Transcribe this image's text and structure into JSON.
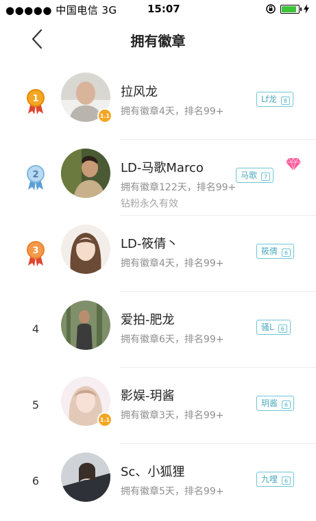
{
  "status_bar": {
    "carrier": "●●●●● 中国电信  3G",
    "time": "15:07"
  },
  "nav": {
    "title": "拥有徽章"
  },
  "colors": {
    "badge_teal": "#6cc5d6",
    "gold_medal": "#f5a623",
    "silver_medal": "#7fb7e0",
    "bronze_medal": "#e8822f",
    "diamond": "#ff5a9a"
  },
  "rows": [
    {
      "rank": "1",
      "name": "拉风龙",
      "sub": "拥有徽章4天，排名99+",
      "badge_label": "Lf龙",
      "badge_level": "8",
      "has_lv_badge": true,
      "lv_text": "1.1"
    },
    {
      "rank": "2",
      "name": "LD-马歌Marco",
      "sub": "拥有徽章122天，排名99+",
      "sub2": "钻粉永久有效",
      "badge_label": "马歌",
      "badge_level": "7"
    },
    {
      "rank": "3",
      "name": "LD-筱倩丶",
      "sub": "拥有徽章4天，排名99+",
      "badge_label": "筱倩",
      "badge_level": "6"
    },
    {
      "rank": "4",
      "name": "爱拍-肥龙",
      "sub": "拥有徽章6天，排名99+",
      "badge_label": "骚L",
      "badge_level": "6"
    },
    {
      "rank": "5",
      "name": "影娱-玥酱",
      "sub": "拥有徽章3天，排名99+",
      "badge_label": "玥酱",
      "badge_level": "6",
      "has_lv_badge": true,
      "lv_text": "1.1"
    },
    {
      "rank": "6",
      "name": "Sc、小狐狸",
      "sub": "拥有徽章5天，排名99+",
      "badge_label": "九哩",
      "badge_level": "6"
    }
  ]
}
